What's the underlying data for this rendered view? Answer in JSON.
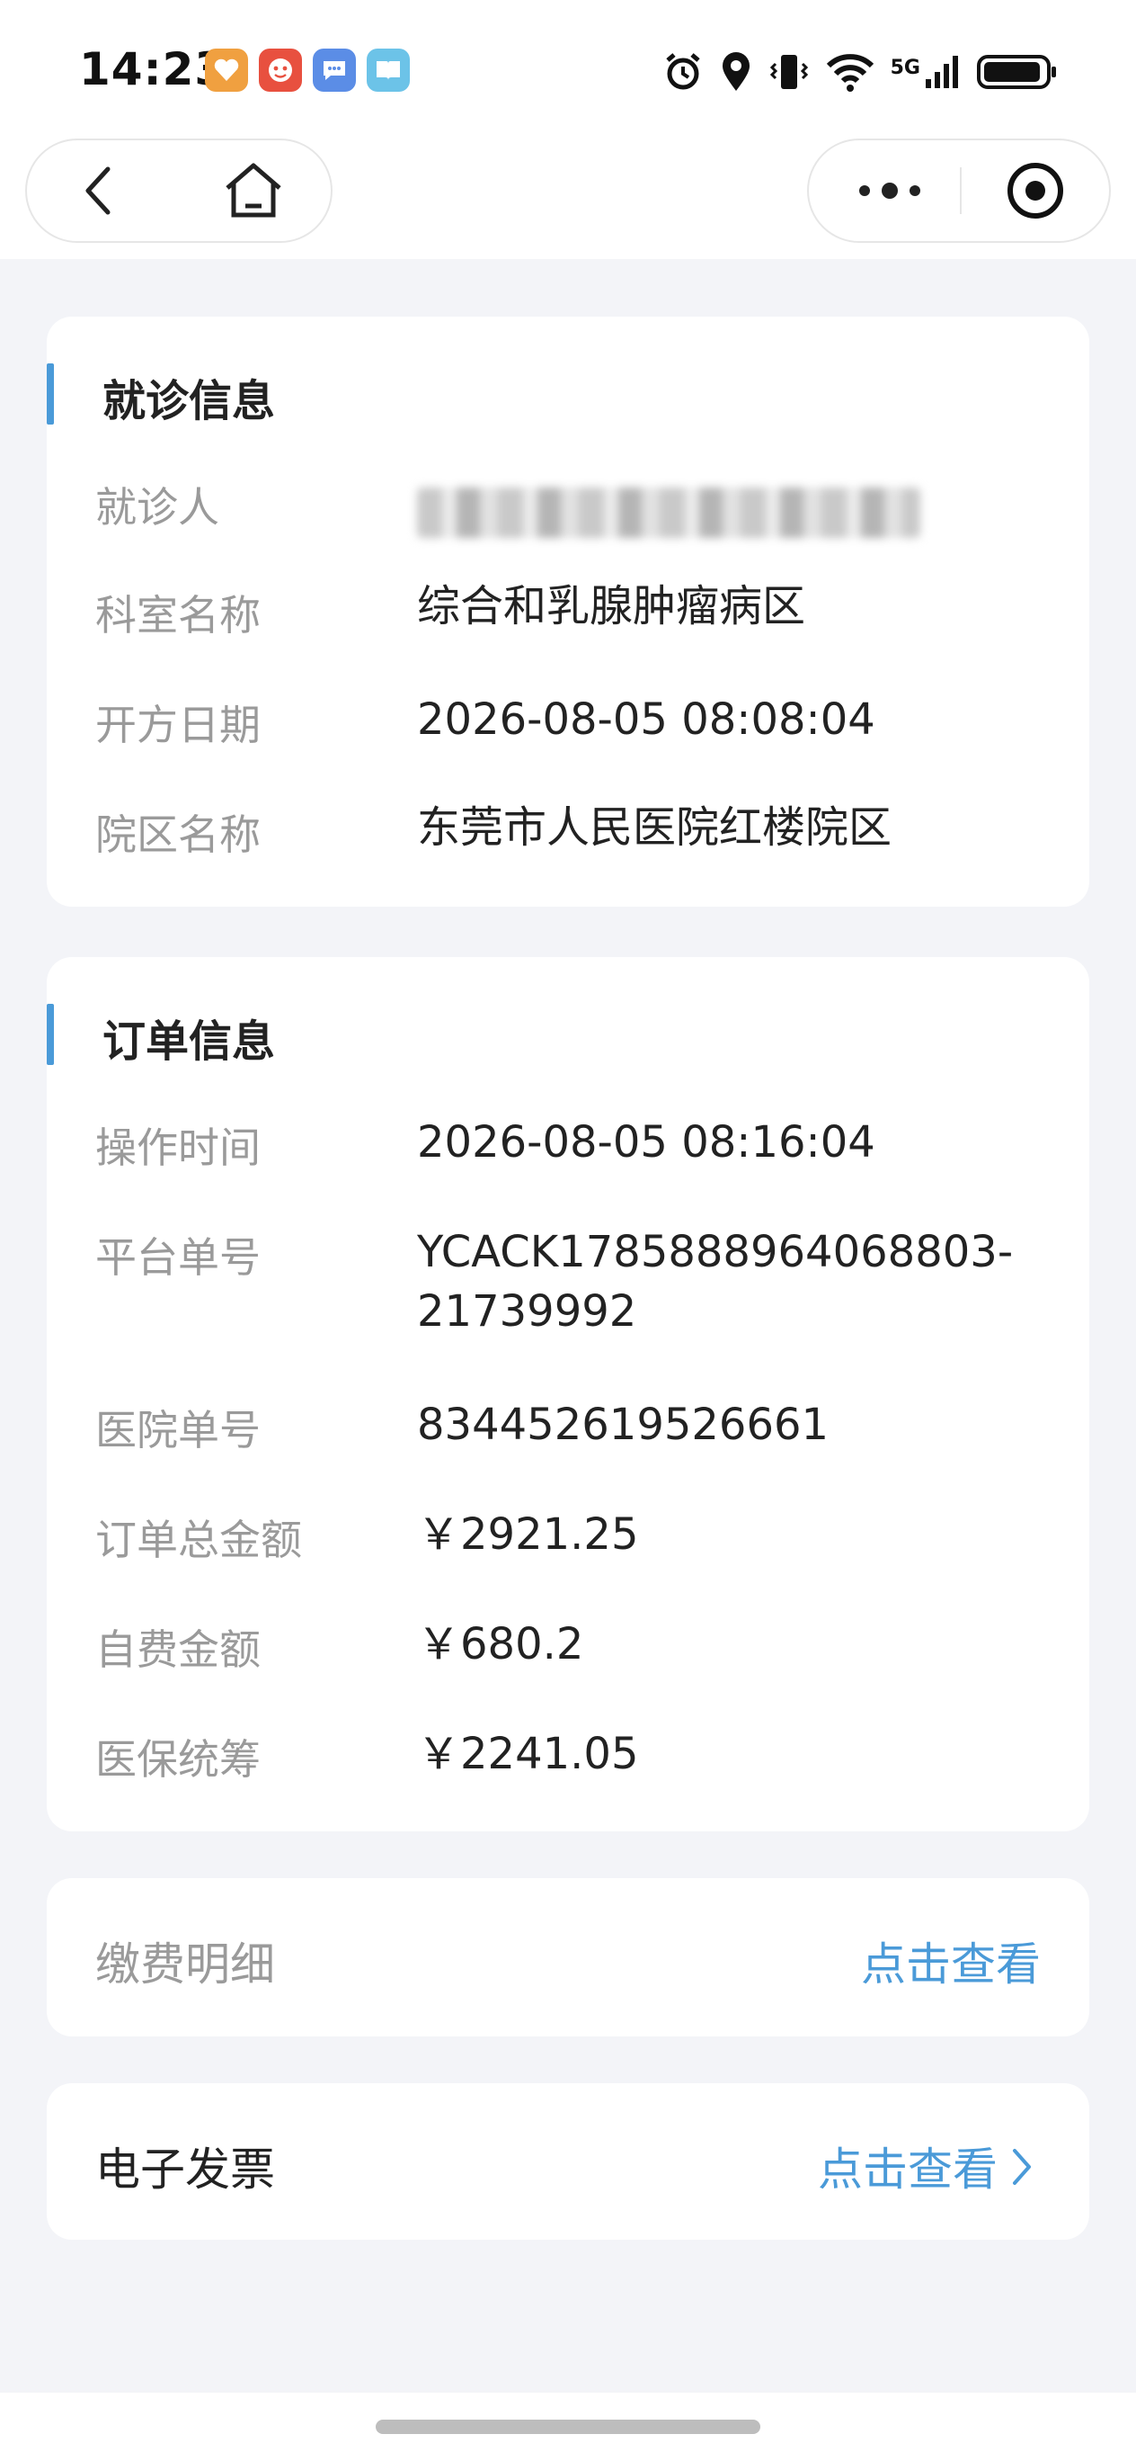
{
  "status_bar": {
    "time": "14:23",
    "network": "5G",
    "app_icons": [
      {
        "name": "heart-app-icon",
        "color": "#f0a040"
      },
      {
        "name": "shopping-618-app-icon",
        "color": "#e8503f"
      },
      {
        "name": "chat-app-icon",
        "color": "#5b8de6"
      },
      {
        "name": "book-app-icon",
        "color": "#6cc3e8"
      }
    ],
    "right_icons": [
      "alarm-icon",
      "location-icon",
      "vibrate-icon",
      "wifi-icon",
      "signal-icon",
      "battery-icon"
    ]
  },
  "nav": {
    "back_icon": "chevron-left-icon",
    "home_icon": "home-icon",
    "more_icon": "more-dots-icon",
    "close_icon": "target-circle-icon"
  },
  "visit_info": {
    "title": "就诊信息",
    "rows": [
      {
        "label": "就诊人",
        "value": ""
      },
      {
        "label": "科室名称",
        "value": "综合和乳腺肿瘤病区"
      },
      {
        "label": "开方日期",
        "value": "2026-08-05 08:08:04"
      },
      {
        "label": "院区名称",
        "value": "东莞市人民医院红楼院区"
      }
    ]
  },
  "order_info": {
    "title": "订单信息",
    "rows": [
      {
        "label": "操作时间",
        "value": "2026-08-05 08:16:04"
      },
      {
        "label": "平台单号",
        "value_line1": "YCACK1785888964068803-",
        "value_line2": "21739992"
      },
      {
        "label": "医院单号",
        "value": "834452619526661"
      },
      {
        "label": "订单总金额",
        "value": "￥2921.25"
      },
      {
        "label": "自费金额",
        "value": "￥680.2"
      },
      {
        "label": "医保统筹",
        "value": "￥2241.05"
      }
    ]
  },
  "payment_detail": {
    "label": "缴费明细",
    "link": "点击查看"
  },
  "e_invoice": {
    "label": "电子发票",
    "link": "点击查看",
    "arrow_icon": "chevron-right-icon"
  },
  "colors": {
    "accent": "#4a9ad8",
    "background": "#f3f4f8",
    "label_gray": "#9a9a9a"
  }
}
